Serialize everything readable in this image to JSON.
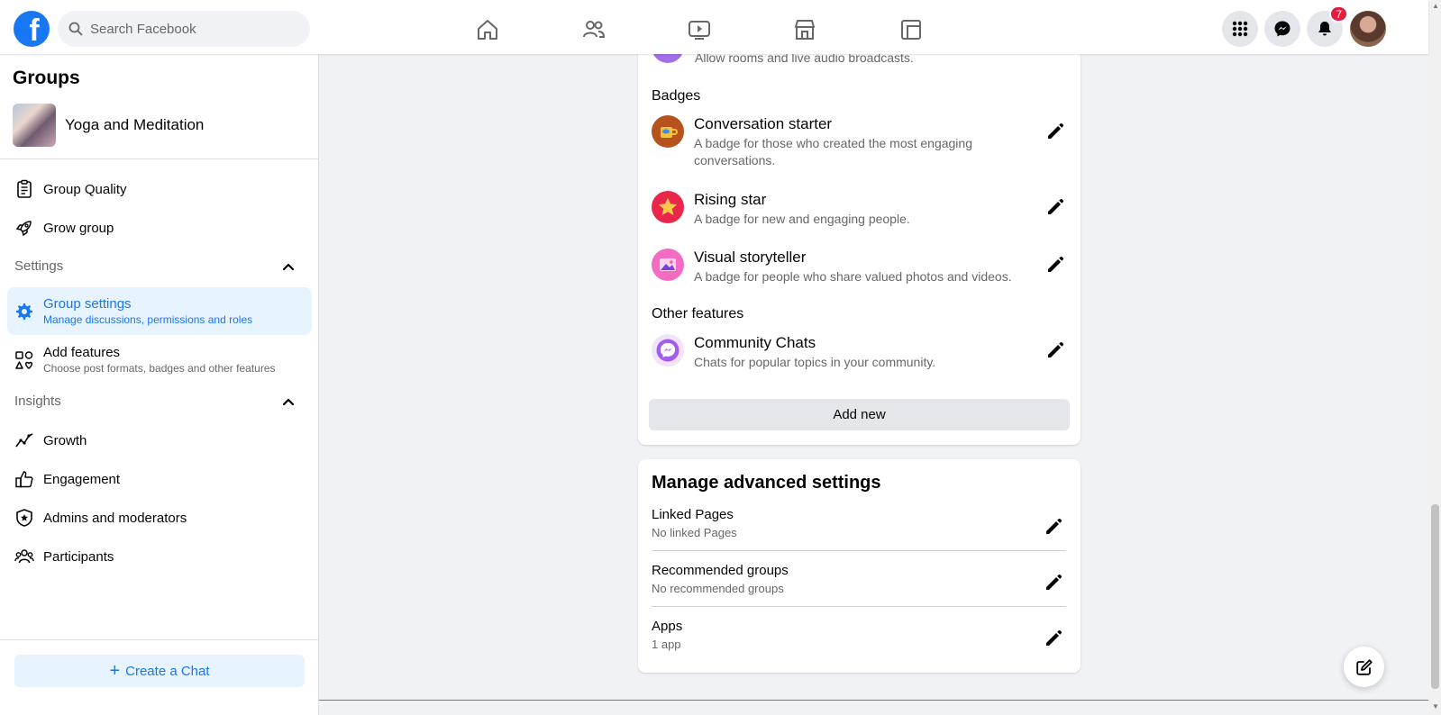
{
  "topbar": {
    "search_placeholder": "Search Facebook",
    "notifications_count": "7",
    "brand_color": "#1877f2"
  },
  "sidebar": {
    "title": "Groups",
    "group_name": "Yoga and Meditation",
    "items": [
      {
        "label": "Group Quality",
        "icon": "clipboard-icon"
      },
      {
        "label": "Grow group",
        "icon": "rocket-icon"
      }
    ],
    "settings_section": "Settings",
    "group_settings": {
      "label": "Group settings",
      "sub": "Manage discussions, permissions and roles"
    },
    "add_features": {
      "label": "Add features",
      "sub": "Choose post formats, badges and other features"
    },
    "insights_section": "Insights",
    "insights": [
      {
        "label": "Growth"
      },
      {
        "label": "Engagement"
      },
      {
        "label": "Admins and moderators"
      },
      {
        "label": "Participants"
      }
    ],
    "create_chat": "Create a Chat"
  },
  "features": {
    "rooms_sub": "Allow rooms and live audio broadcasts.",
    "badges_heading": "Badges",
    "badges": [
      {
        "title": "Conversation starter",
        "desc": "A badge for those who created the most engaging conversations."
      },
      {
        "title": "Rising star",
        "desc": "A badge for new and engaging people."
      },
      {
        "title": "Visual storyteller",
        "desc": "A badge for people who share valued photos and videos."
      }
    ],
    "other_heading": "Other features",
    "other": [
      {
        "title": "Community Chats",
        "desc": "Chats for popular topics in your community."
      }
    ],
    "add_new": "Add new"
  },
  "advanced": {
    "title": "Manage advanced settings",
    "rows": [
      {
        "title": "Linked Pages",
        "sub": "No linked Pages"
      },
      {
        "title": "Recommended groups",
        "sub": "No recommended groups"
      },
      {
        "title": "Apps",
        "sub": "1 app"
      }
    ]
  }
}
